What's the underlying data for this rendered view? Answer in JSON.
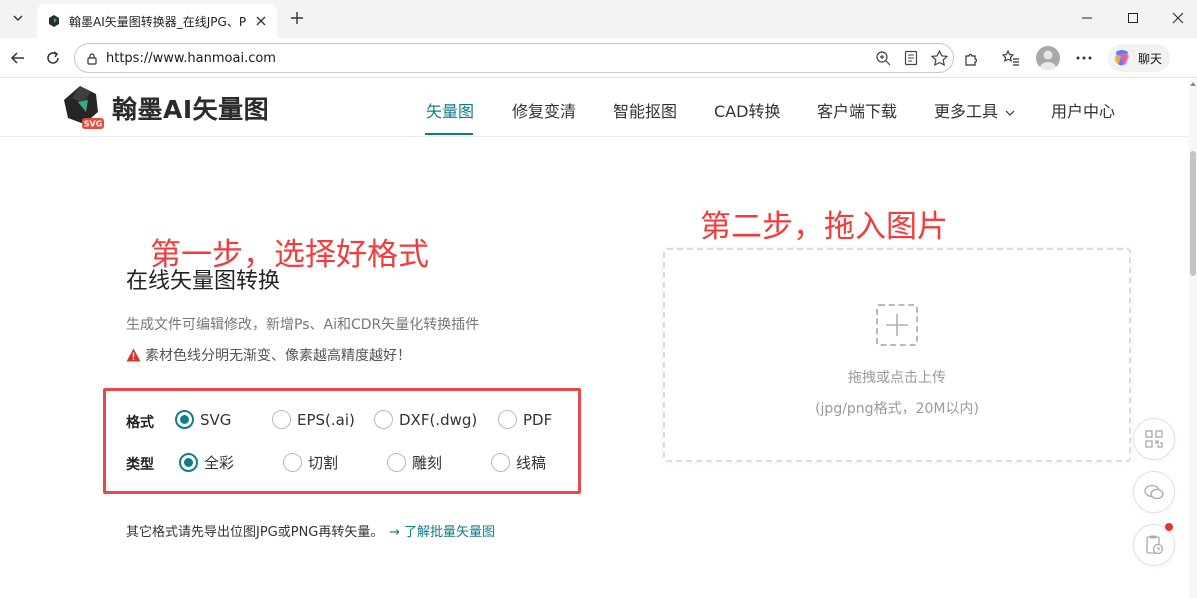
{
  "browser": {
    "tab_title": "翰墨AI矢量图转换器_在线JPG、PNG",
    "url": "https://www.hanmoai.com",
    "copilot_label": "聊天"
  },
  "site": {
    "logo_text": "翰墨AI矢量图",
    "logo_badge": "SVG",
    "nav": [
      {
        "label": "矢量图"
      },
      {
        "label": "修复变清"
      },
      {
        "label": "智能抠图"
      },
      {
        "label": "CAD转换"
      },
      {
        "label": "客户端下载"
      },
      {
        "label": "更多工具"
      },
      {
        "label": "用户中心"
      }
    ]
  },
  "annotations": {
    "step1": "第一步，选择好格式",
    "step2": "第二步，拖入图片"
  },
  "main": {
    "title": "在线矢量图转换",
    "subtitle": "生成文件可编辑修改，新增Ps、Ai和CDR矢量化转换插件",
    "warning": "素材色线分明无渐变、像素越高精度越好！",
    "format_label": "格式",
    "formats": [
      {
        "label": "SVG",
        "checked": true
      },
      {
        "label": "EPS(.ai)",
        "checked": false
      },
      {
        "label": "DXF(.dwg)",
        "checked": false
      },
      {
        "label": "PDF",
        "checked": false
      }
    ],
    "type_label": "类型",
    "types": [
      {
        "label": "全彩",
        "checked": true
      },
      {
        "label": "切割",
        "checked": false
      },
      {
        "label": "雕刻",
        "checked": false
      },
      {
        "label": "线稿",
        "checked": false
      }
    ],
    "note": "其它格式请先导出位图JPG或PNG再转矢量。",
    "note_link": "→ 了解批量矢量图"
  },
  "upload": {
    "primary": "拖拽或点击上传",
    "secondary": "(jpg/png格式，20M以内)"
  },
  "colors": {
    "accent": "#0e7e86",
    "annotation": "#f23c3c"
  }
}
